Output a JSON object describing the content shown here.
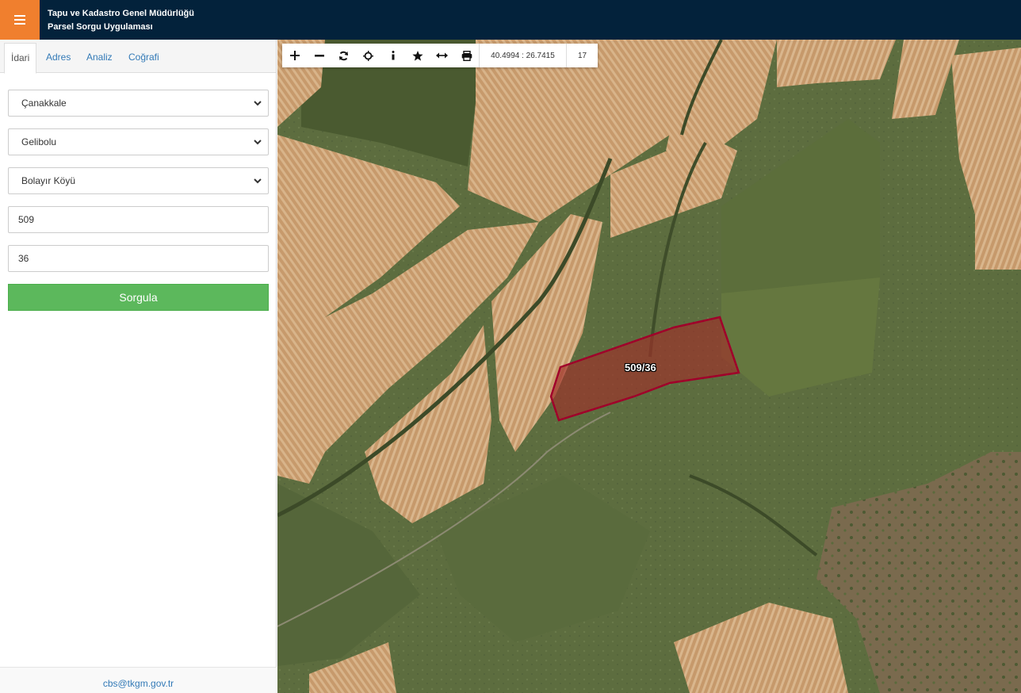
{
  "header": {
    "title_line1": "Tapu ve Kadastro Genel Müdürlüğü",
    "title_line2": "Parsel Sorgu Uygulaması",
    "menu_icon": "hamburger-menu-icon",
    "colors": {
      "bar": "#03223b",
      "menu": "#f07f2e"
    }
  },
  "sidebar": {
    "tabs": [
      {
        "label": "İdari",
        "active": true
      },
      {
        "label": "Adres",
        "active": false
      },
      {
        "label": "Analiz",
        "active": false
      },
      {
        "label": "Coğrafi",
        "active": false
      }
    ],
    "form": {
      "province": "Çanakkale",
      "district": "Gelibolu",
      "neighborhood": "Bolayır Köyü",
      "block": "509",
      "parcel": "36",
      "submit_label": "Sorgula"
    },
    "footer_email": "cbs@tkgm.gov.tr"
  },
  "map": {
    "toolbar": {
      "tools": [
        "zoom-in-icon",
        "zoom-out-icon",
        "refresh-icon",
        "locate-icon",
        "info-icon",
        "favorite-star-icon",
        "measure-icon",
        "print-icon"
      ],
      "coordinates": "40.4994 : 26.7415",
      "zoom_level": "17"
    },
    "parcel_label": "509/36",
    "colors": {
      "parcel_fill": "#a0302a",
      "parcel_stroke": "#a0002a"
    }
  }
}
